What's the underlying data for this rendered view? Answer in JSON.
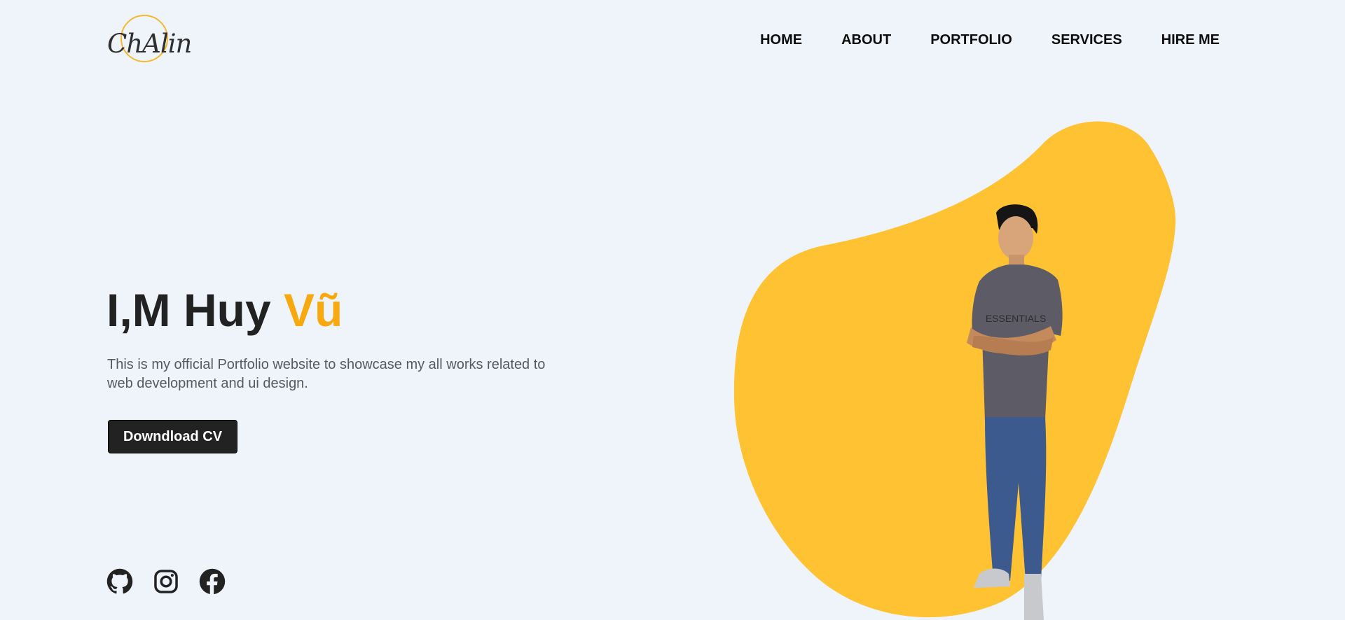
{
  "logo": {
    "text": "ChAlin"
  },
  "nav": {
    "items": [
      "HOME",
      "ABOUT",
      "PORTFOLIO",
      "SERVICES",
      "HIRE ME"
    ]
  },
  "hero": {
    "title_main": "I,M Huy ",
    "title_accent": "Vũ",
    "description": "This is my official Portfolio website to showcase my all works related to web development and ui design.",
    "cta_label": "Downdload CV"
  },
  "socials": {
    "icons": [
      "github-icon",
      "instagram-icon",
      "facebook-icon"
    ]
  },
  "illustration": {
    "shirt_text": "ESSENTIALS"
  },
  "colors": {
    "background": "#eff4fb",
    "accent": "#f8a90f",
    "blob": "#fec233",
    "button": "#222222"
  }
}
